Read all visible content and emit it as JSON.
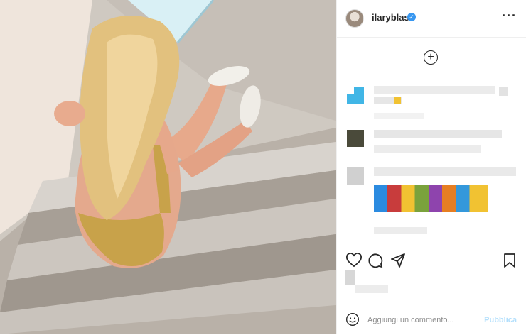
{
  "post": {
    "username": "ilaryblasi",
    "verified_mark": "✓",
    "more_label": "···",
    "load_more_label": "+"
  },
  "composer": {
    "placeholder": "Aggiungi un commento...",
    "publish_label": "Pubblica"
  },
  "icons": {
    "like": "heart-icon",
    "comment": "comment-icon",
    "share": "send-icon",
    "save": "bookmark-icon",
    "emoji": "emoji-icon"
  },
  "colors": {
    "link_disabled": "#b2dffc",
    "verified": "#3897f0",
    "text": "#262626"
  }
}
